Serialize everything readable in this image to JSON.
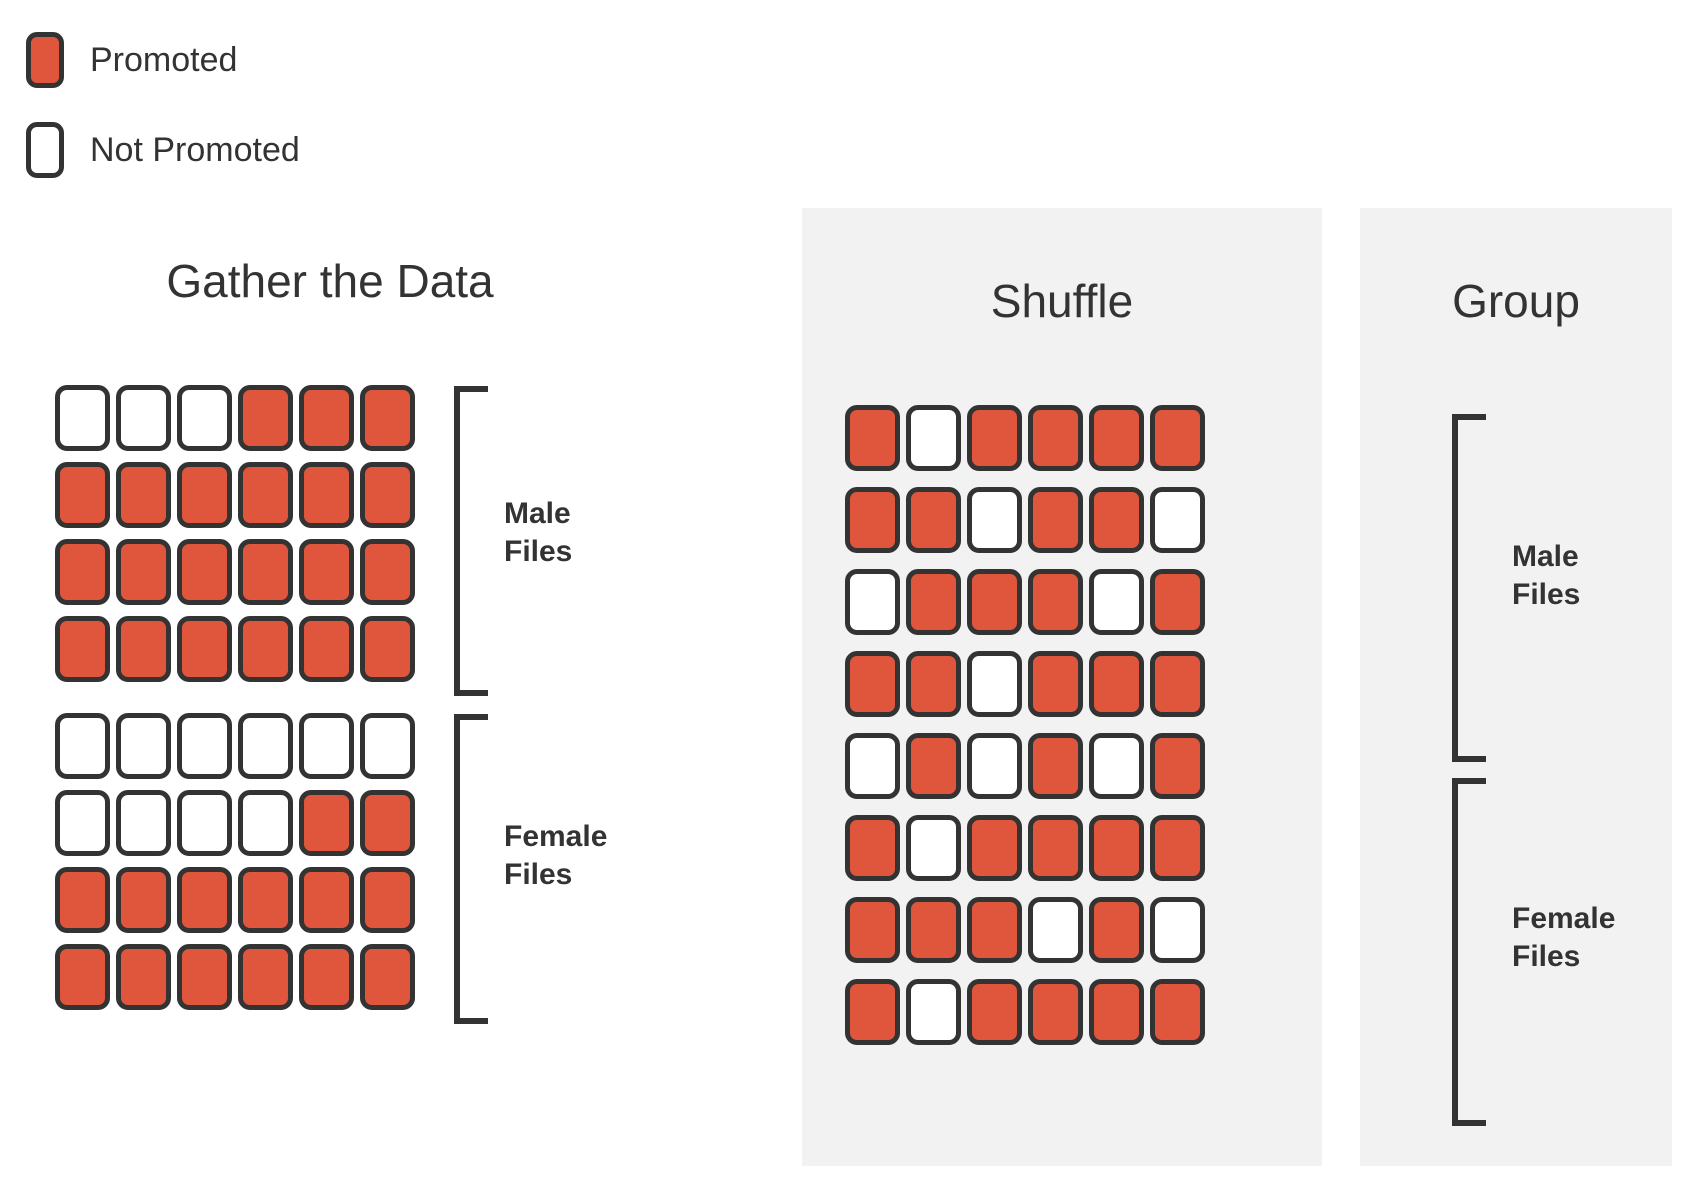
{
  "legend": {
    "items": [
      {
        "label": "Promoted",
        "state": "promoted",
        "icon": "filled-card-icon",
        "color": "#e0563c"
      },
      {
        "label": "Not Promoted",
        "state": "not-promoted",
        "icon": "empty-card-icon",
        "color": "#ffffff"
      }
    ]
  },
  "colors": {
    "promoted": "#e0563c",
    "not_promoted": "#ffffff",
    "outline": "#333333",
    "panel_background": "#f2f2f2",
    "page_background": "#ffffff"
  },
  "panels": {
    "gather": {
      "title": "Gather the Data"
    },
    "shuffle": {
      "title": "Shuffle"
    },
    "group": {
      "title": "Group"
    }
  },
  "bracket_labels": {
    "male": "Male\nFiles",
    "female": "Female\nFiles"
  },
  "chart_data": {
    "type": "diagram",
    "title": "Permutation test illustration: Gather the Data, Shuffle, Group",
    "legend": [
      "Promoted",
      "Not Promoted"
    ],
    "cell_states": [
      "promoted",
      "not-promoted"
    ],
    "grid_shape": {
      "rows": 8,
      "cols": 6
    },
    "panels": [
      {
        "name": "gather",
        "title": "Gather the Data",
        "groups": [
          {
            "name": "male",
            "label": "Male\nFiles",
            "rows": [
              [
                "not-promoted",
                "not-promoted",
                "not-promoted",
                "promoted",
                "promoted",
                "promoted"
              ],
              [
                "promoted",
                "promoted",
                "promoted",
                "promoted",
                "promoted",
                "promoted"
              ],
              [
                "promoted",
                "promoted",
                "promoted",
                "promoted",
                "promoted",
                "promoted"
              ],
              [
                "promoted",
                "promoted",
                "promoted",
                "promoted",
                "promoted",
                "promoted"
              ]
            ],
            "promoted_count": 21,
            "total": 24
          },
          {
            "name": "female",
            "label": "Female\nFiles",
            "rows": [
              [
                "not-promoted",
                "not-promoted",
                "not-promoted",
                "not-promoted",
                "not-promoted",
                "not-promoted"
              ],
              [
                "not-promoted",
                "not-promoted",
                "not-promoted",
                "not-promoted",
                "promoted",
                "promoted"
              ],
              [
                "promoted",
                "promoted",
                "promoted",
                "promoted",
                "promoted",
                "promoted"
              ],
              [
                "promoted",
                "promoted",
                "promoted",
                "promoted",
                "promoted",
                "promoted"
              ]
            ],
            "promoted_count": 14,
            "total": 24
          }
        ]
      },
      {
        "name": "shuffle",
        "title": "Shuffle",
        "rows": [
          [
            "promoted",
            "not-promoted",
            "promoted",
            "promoted",
            "promoted",
            "promoted"
          ],
          [
            "promoted",
            "promoted",
            "not-promoted",
            "promoted",
            "promoted",
            "not-promoted"
          ],
          [
            "not-promoted",
            "promoted",
            "promoted",
            "promoted",
            "not-promoted",
            "promoted"
          ],
          [
            "promoted",
            "promoted",
            "not-promoted",
            "promoted",
            "promoted",
            "promoted"
          ],
          [
            "not-promoted",
            "promoted",
            "not-promoted",
            "promoted",
            "not-promoted",
            "promoted"
          ],
          [
            "promoted",
            "not-promoted",
            "promoted",
            "promoted",
            "promoted",
            "promoted"
          ],
          [
            "promoted",
            "promoted",
            "promoted",
            "not-promoted",
            "promoted",
            "not-promoted"
          ],
          [
            "promoted",
            "not-promoted",
            "promoted",
            "promoted",
            "promoted",
            "promoted"
          ]
        ],
        "promoted_count": 35,
        "total": 48
      },
      {
        "name": "group",
        "title": "Group",
        "groups": [
          {
            "name": "male",
            "label": "Male\nFiles"
          },
          {
            "name": "female",
            "label": "Female\nFiles"
          }
        ]
      }
    ]
  }
}
